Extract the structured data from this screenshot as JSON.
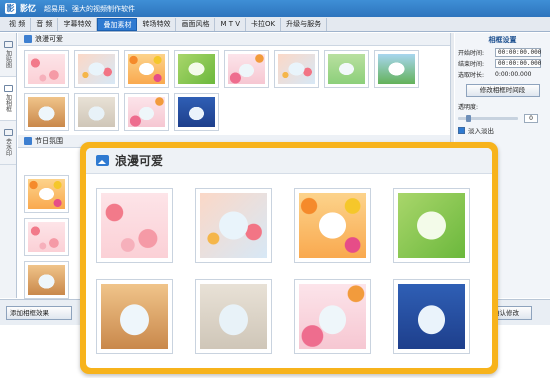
{
  "app": {
    "name": "影忆",
    "tagline": "超易用、强大的视频制作软件",
    "logo": "影"
  },
  "tabs": [
    {
      "label": "视 频"
    },
    {
      "label": "音 频"
    },
    {
      "label": "字幕特效"
    },
    {
      "label": "叠加素材",
      "active": true
    },
    {
      "label": "转场特效"
    },
    {
      "label": "画面风格"
    },
    {
      "label": "M T V"
    },
    {
      "label": "卡拉OK"
    },
    {
      "label": "升级与服务"
    }
  ],
  "leftnav": [
    {
      "label": "加贴图",
      "icon": "sticker-icon"
    },
    {
      "label": "加相框",
      "icon": "frame-icon",
      "active": true
    },
    {
      "label": "去水印",
      "icon": "watermark-icon"
    }
  ],
  "library": {
    "section1": "浪漫可爱",
    "section2": "节日氛围"
  },
  "right": {
    "title": "相框设置",
    "start_label": "开始时间:",
    "start_value": "00:00:00.000",
    "end_label": "结束时间:",
    "end_value": "00:00:00.000",
    "duration_label": "选取时长:",
    "duration_value": "0:00:00.000",
    "fix_btn": "修改相框时间段",
    "opacity_label": "透明度:",
    "opacity_value": "0",
    "fade_label": "淡入淡出",
    "modify_btn": "确认修改"
  },
  "bottom": {
    "add_btn": "添加相框效果"
  },
  "popup": {
    "title": "浪漫可爱"
  },
  "colors": {
    "accent": "#2f7ad1",
    "popup_border": "#f7b31c"
  }
}
